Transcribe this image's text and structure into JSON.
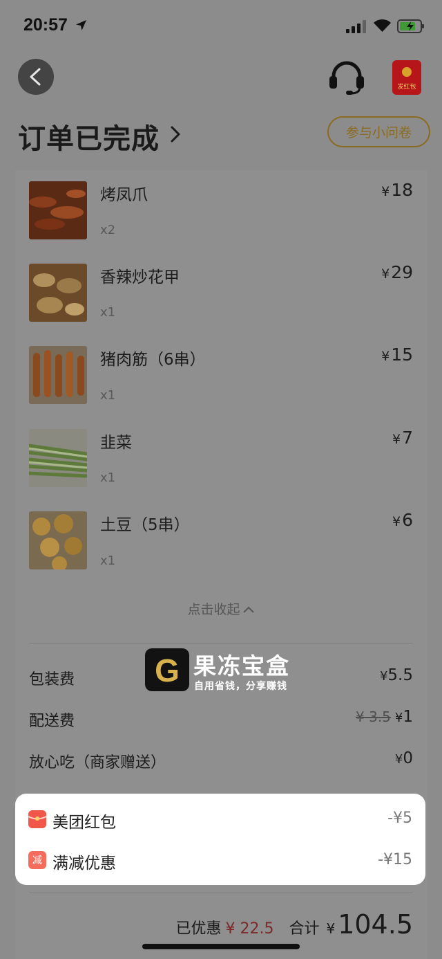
{
  "status_bar": {
    "time": "20:57"
  },
  "header": {
    "title": "订单已完成",
    "survey_button": "参与小问卷",
    "red_packet_label": "发红包"
  },
  "items": [
    {
      "name": "烤凤爪",
      "qty": "x2",
      "price": "18",
      "currency": "¥"
    },
    {
      "name": "香辣炒花甲",
      "qty": "x1",
      "price": "29",
      "currency": "¥"
    },
    {
      "name": "猪肉筋（6串）",
      "qty": "x1",
      "price": "15",
      "currency": "¥"
    },
    {
      "name": "韭菜",
      "qty": "x1",
      "price": "7",
      "currency": "¥"
    },
    {
      "name": "土豆（5串）",
      "qty": "x1",
      "price": "6",
      "currency": "¥"
    }
  ],
  "collapse_label": "点击收起",
  "fees": [
    {
      "label": "包装费",
      "currency": "¥",
      "value": "5.5"
    },
    {
      "label": "配送费",
      "original": "¥ 3.5",
      "currency": "¥",
      "value": "1"
    },
    {
      "label": "放心吃（商家赠送）",
      "currency": "¥",
      "value": "0"
    }
  ],
  "discounts": [
    {
      "icon_text": "",
      "icon_color": "#f0564a",
      "label": "美团红包",
      "value": "-¥5"
    },
    {
      "icon_text": "减",
      "icon_color": "#f56b5c",
      "label": "满减优惠",
      "value": "-¥15"
    }
  ],
  "summary": {
    "saved_label": "已优惠",
    "saved_value": "¥ 22.5",
    "total_label": "合计",
    "currency": "¥",
    "total": "104.5"
  },
  "watermark": {
    "logo_letter": "G",
    "title": "果冻宝盒",
    "subtitle": "自用省钱，分享赚钱"
  }
}
